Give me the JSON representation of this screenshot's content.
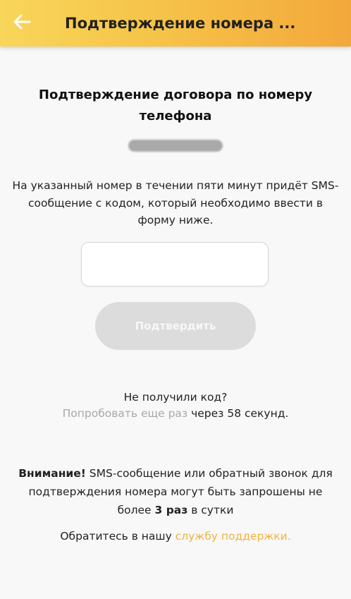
{
  "header": {
    "title": "Подтверждение номера ...",
    "back_icon": "arrow-left-icon"
  },
  "colors": {
    "header_gradient_start": "#f8d65a",
    "header_gradient_end": "#f3a83b",
    "button_disabled": "#dcdcdc",
    "link_gray": "#a8a8a8",
    "link_accent": "#f0b33f"
  },
  "main": {
    "title": "Подтверждение договора по номеру телефона",
    "info_text": "На указанный номер в течении пяти минут придёт SMS-сообщение с кодом, который необходимо ввести в форму ниже.",
    "code_input": {
      "value": "",
      "placeholder": ""
    },
    "confirm_button": "Подтвердить",
    "no_code": "Не получили код?",
    "retry_link": "Попробовать еще раз",
    "retry_suffix": " через 58 секунд."
  },
  "warning": {
    "label": "Внимание!",
    "text_1": " SMS-сообщение или обратный звонок для подтверждения номера могут быть запрошены не более ",
    "limit": "3 раз",
    "text_2": "  в сутки"
  },
  "support": {
    "prefix": "Обратитесь в нашу ",
    "link": "службу поддержки."
  }
}
